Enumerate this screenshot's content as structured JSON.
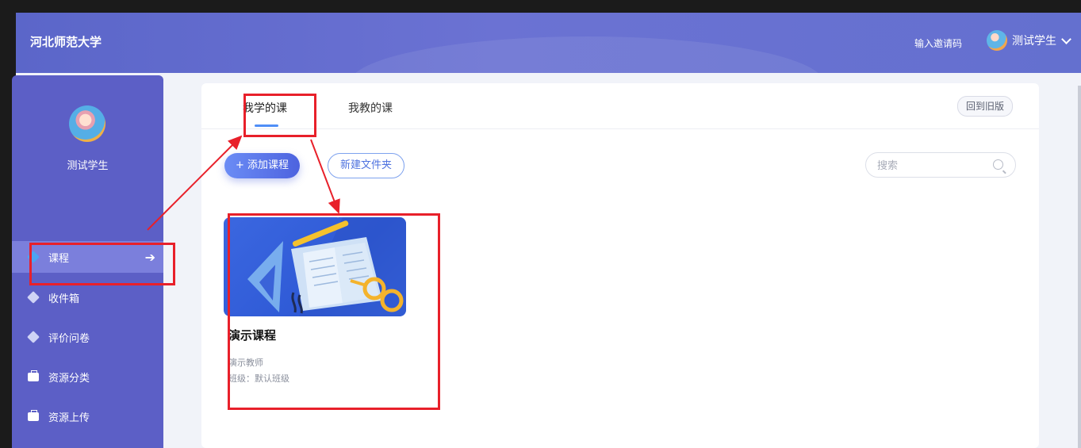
{
  "header": {
    "brand": "河北师范大学",
    "invite_code": "输入邀请码",
    "user_name": "测试学生"
  },
  "sidebar": {
    "user_name": "测试学生",
    "items": [
      {
        "label": "课程",
        "icon": "cube-icon",
        "active": true
      },
      {
        "label": "收件箱",
        "icon": "cube-icon"
      },
      {
        "label": "评价问卷",
        "icon": "cube-icon"
      },
      {
        "label": "资源分类",
        "icon": "briefcase-icon"
      },
      {
        "label": "资源上传",
        "icon": "briefcase-icon"
      }
    ]
  },
  "main": {
    "tabs": [
      {
        "label": "我学的课",
        "active": true
      },
      {
        "label": "我教的课"
      }
    ],
    "back_old_version": "回到旧版",
    "add_course": "+ 添加课程",
    "new_folder": "新建文件夹",
    "search": {
      "placeholder": "搜索"
    },
    "courses": [
      {
        "title": "演示课程",
        "teacher": "演示教师",
        "class_info": "班级：默认班级"
      }
    ]
  },
  "colors": {
    "header": "#6470cf",
    "sidebar": "#5c5fc6",
    "sidebar_active": "#7b7fdc",
    "accent": "#4f8ef7",
    "annotation": "#e8202a"
  }
}
